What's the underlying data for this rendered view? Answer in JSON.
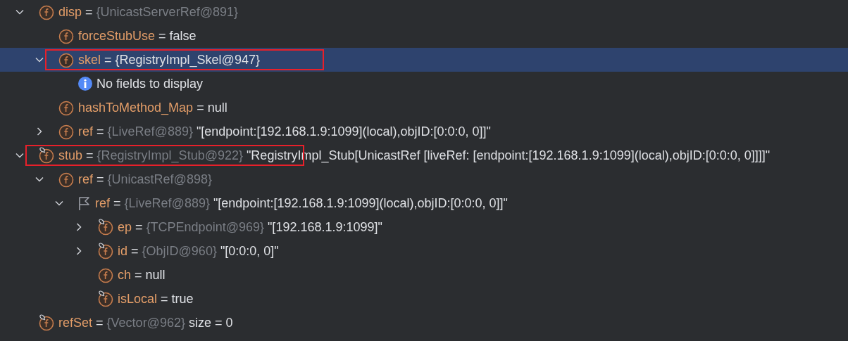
{
  "tree": [
    {
      "kind": "field",
      "name": "disp",
      "operator": "=",
      "type": "{UnicastServerRef@891}",
      "expanded": true,
      "selected": false,
      "highlighted": false,
      "children": [
        {
          "kind": "field",
          "name": "forceStubUse",
          "operator": "=",
          "value": "false",
          "selected": false,
          "highlighted": false
        },
        {
          "kind": "field",
          "name": "skel",
          "operator": "=",
          "value": "{RegistryImpl_Skel@947}",
          "expanded": true,
          "selected": true,
          "highlighted": true,
          "children": [
            {
              "kind": "info",
              "message": "No fields to display",
              "selected": false,
              "highlighted": false
            }
          ]
        },
        {
          "kind": "field",
          "name": "hashToMethod_Map",
          "operator": "=",
          "value": "null",
          "selected": false,
          "highlighted": false
        },
        {
          "kind": "field",
          "name": "ref",
          "operator": "=",
          "type": "{LiveRef@889}",
          "value": "\"[endpoint:[192.168.1.9:1099](local),objID:[0:0:0, 0]]\"",
          "expanded": false,
          "selected": false,
          "highlighted": false
        }
      ]
    },
    {
      "kind": "linked-field",
      "name": "stub",
      "operator": "=",
      "type": "{RegistryImpl_Stub@922}",
      "value": "\"RegistryImpl_Stub[UnicastRef [liveRef: [endpoint:[192.168.1.9:1099](local),objID:[0:0:0, 0]]]]\"",
      "expanded": true,
      "selected": false,
      "highlighted": true,
      "children": [
        {
          "kind": "field",
          "name": "ref",
          "operator": "=",
          "type": "{UnicastRef@898}",
          "expanded": true,
          "selected": false,
          "highlighted": false,
          "children": [
            {
              "kind": "flag",
              "name": "ref",
              "operator": "=",
              "type": "{LiveRef@889}",
              "value": "\"[endpoint:[192.168.1.9:1099](local),objID:[0:0:0, 0]]\"",
              "expanded": true,
              "selected": false,
              "highlighted": false,
              "children": [
                {
                  "kind": "linked-field",
                  "name": "ep",
                  "operator": "=",
                  "type": "{TCPEndpoint@969}",
                  "value": "\"[192.168.1.9:1099]\"",
                  "expanded": false,
                  "selected": false,
                  "highlighted": false
                },
                {
                  "kind": "linked-field",
                  "name": "id",
                  "operator": "=",
                  "type": "{ObjID@960}",
                  "value": "\"[0:0:0, 0]\"",
                  "expanded": false,
                  "selected": false,
                  "highlighted": false
                },
                {
                  "kind": "field",
                  "name": "ch",
                  "operator": "=",
                  "value": "null",
                  "selected": false,
                  "highlighted": false
                },
                {
                  "kind": "linked-field",
                  "name": "isLocal",
                  "operator": "=",
                  "value": "true",
                  "selected": false,
                  "highlighted": false
                }
              ]
            }
          ]
        }
      ]
    },
    {
      "kind": "linked-field",
      "name": "refSet",
      "operator": "=",
      "type": "{Vector@962}",
      "value": "size = 0",
      "selected": false,
      "highlighted": false
    }
  ]
}
